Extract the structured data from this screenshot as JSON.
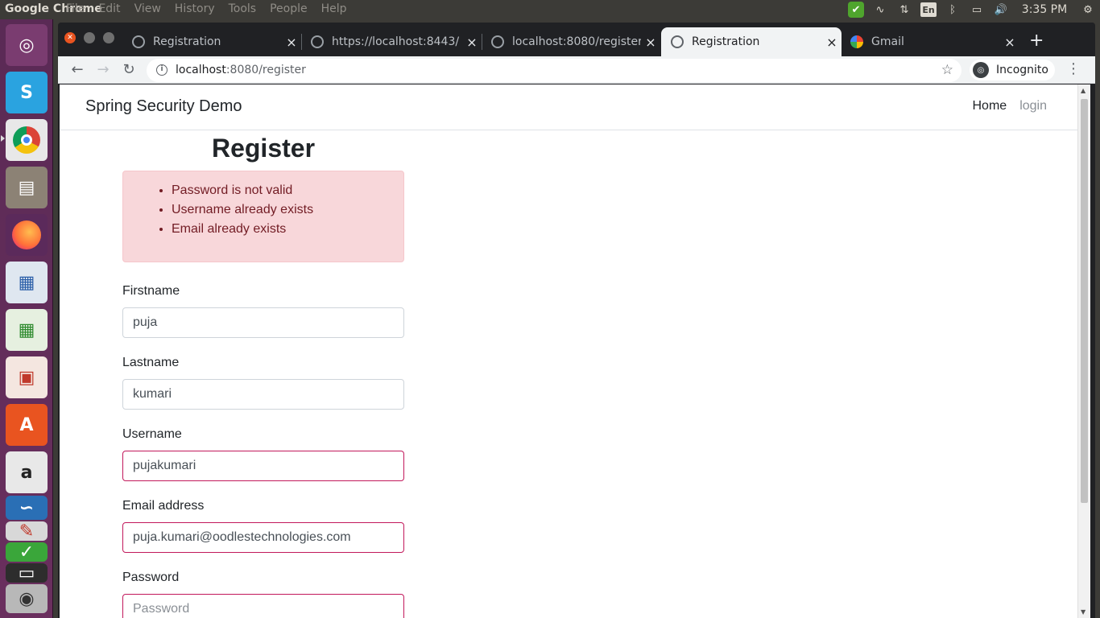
{
  "top_panel": {
    "app_title": "Google Chrome",
    "menu": [
      "File",
      "Edit",
      "View",
      "History",
      "Tools",
      "People",
      "Help"
    ],
    "keyboard_layout": "En",
    "clock": "3:35 PM"
  },
  "launcher": {
    "items": [
      "ubuntu-dash",
      "skype",
      "chrome",
      "files",
      "firefox",
      "writer",
      "calc",
      "impress",
      "software-center",
      "amazon",
      "app-1",
      "app-2",
      "app-3",
      "app-4",
      "app-5"
    ]
  },
  "browser": {
    "tabs": [
      {
        "label": "Registration",
        "active": false
      },
      {
        "label": "https://localhost:8443/",
        "active": false
      },
      {
        "label": "localhost:8080/register",
        "active": false
      },
      {
        "label": "Registration",
        "active": true
      },
      {
        "label": "Gmail",
        "active": false
      }
    ],
    "new_tab_symbol": "+",
    "tab_close_symbol": "×",
    "address": {
      "host": "localhost",
      "path": ":8080/register"
    },
    "incognito_label": "Incognito"
  },
  "page": {
    "brand": "Spring Security Demo",
    "nav": {
      "home": "Home",
      "login": "login"
    },
    "heading": "Register",
    "errors": [
      "Password is not valid",
      "Username already exists",
      "Email already exists"
    ],
    "fields": {
      "firstname": {
        "label": "Firstname",
        "value": "puja"
      },
      "lastname": {
        "label": "Lastname",
        "value": "kumari"
      },
      "username": {
        "label": "Username",
        "value": "pujakumari"
      },
      "email": {
        "label": "Email address",
        "value": "puja.kumari@oodlestechnologies.com"
      },
      "password": {
        "label": "Password",
        "value": "",
        "placeholder": "Password"
      }
    }
  },
  "colors": {
    "alert_bg": "#f8d7da",
    "alert_text": "#721c24",
    "invalid_border": "#c2185b",
    "launcher_bg": "#5a2a55",
    "panel_bg": "#3c3b37"
  }
}
